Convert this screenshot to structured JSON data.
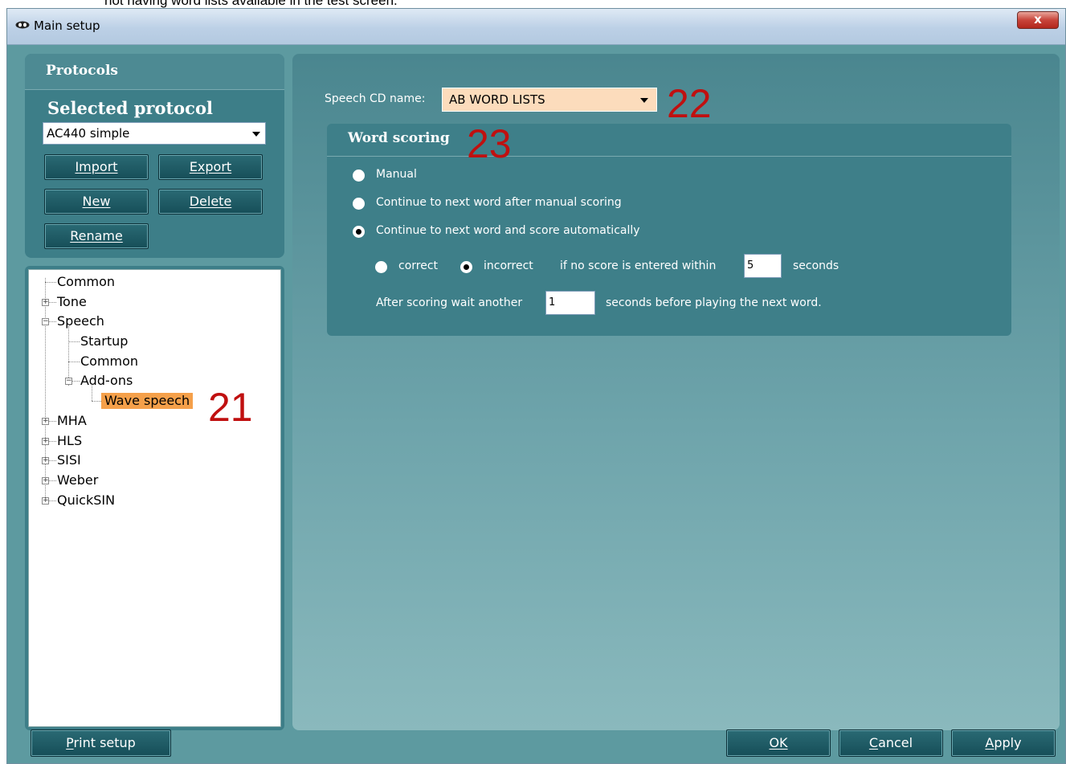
{
  "doc_text": "not having word lists available in the test screen.",
  "window": {
    "title": "Main setup",
    "close_label": "x"
  },
  "protocols": {
    "header": "Protocols",
    "selected_label": "Selected protocol",
    "selected_value": "AC440 simple",
    "buttons": {
      "import_u": "I",
      "import_rest": "mport",
      "export_u": "E",
      "export_rest": "xport",
      "new_u": "N",
      "new_rest": "ew",
      "delete_u": "D",
      "delete_rest": "elete",
      "rename_u": "R",
      "rename_rest": "ename"
    }
  },
  "tree": {
    "common": "Common",
    "tone": "Tone",
    "speech": "Speech",
    "startup": "Startup",
    "speech_common": "Common",
    "addons": "Add-ons",
    "wave_speech": "Wave speech",
    "mha": "MHA",
    "hls": "HLS",
    "sisi": "SISI",
    "weber": "Weber",
    "quicksin": "QuickSIN"
  },
  "speech_cd": {
    "label": "Speech CD name:",
    "value": "AB WORD LISTS"
  },
  "word_scoring": {
    "header": "Word scoring",
    "options": [
      "Manual",
      "Continue to next word after manual scoring",
      "Continue to next word and score automatically"
    ],
    "selected_index": 2,
    "auto": {
      "correct": "correct",
      "incorrect": "incorrect",
      "selected": "incorrect",
      "within_text": "if no score is entered within",
      "seconds_value": "5",
      "seconds_label": "seconds",
      "wait_text": "After scoring wait another",
      "wait_value": "1",
      "wait_suffix": "seconds before playing the next word."
    }
  },
  "annotations": {
    "tree": "21",
    "cd": "22",
    "scoring": "23"
  },
  "bottom": {
    "print_u": "P",
    "print_rest": "rint setup",
    "ok_u": "O",
    "ok_rest": "K",
    "cancel_u": "C",
    "cancel_rest": "ancel",
    "apply_u": "A",
    "apply_rest": "pply"
  },
  "colors": {
    "panel": "#3d7e88",
    "accent_highlight": "#f5a04a",
    "cd_field": "#fcdcbc",
    "annotation": "#c01010"
  }
}
